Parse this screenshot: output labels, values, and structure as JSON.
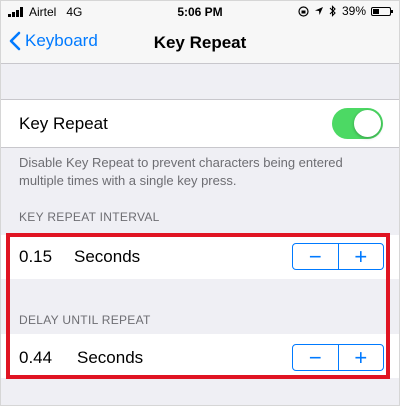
{
  "status_bar": {
    "carrier": "Airtel",
    "network": "4G",
    "time": "5:06 PM",
    "battery": "39%",
    "battery_level": 0.39,
    "icons": [
      "signal-bars-icon",
      "orientation-lock-icon",
      "location-arrow-icon",
      "bluetooth-icon",
      "battery-icon"
    ]
  },
  "nav": {
    "back_label": "Keyboard",
    "title": "Key Repeat"
  },
  "key_repeat": {
    "label": "Key Repeat",
    "enabled": true,
    "description": "Disable Key Repeat to prevent characters being entered multiple times with a single key press."
  },
  "interval": {
    "header": "KEY REPEAT INTERVAL",
    "value": "0.15",
    "unit": "Seconds",
    "minus": "−",
    "plus": "+"
  },
  "delay": {
    "header": "DELAY UNTIL REPEAT",
    "value": "0.44",
    "unit": "Seconds",
    "minus": "−",
    "plus": "+"
  },
  "colors": {
    "accent": "#007aff",
    "toggle_on": "#4cd964",
    "highlight": "#e01422",
    "group_background": "#efeff4"
  }
}
